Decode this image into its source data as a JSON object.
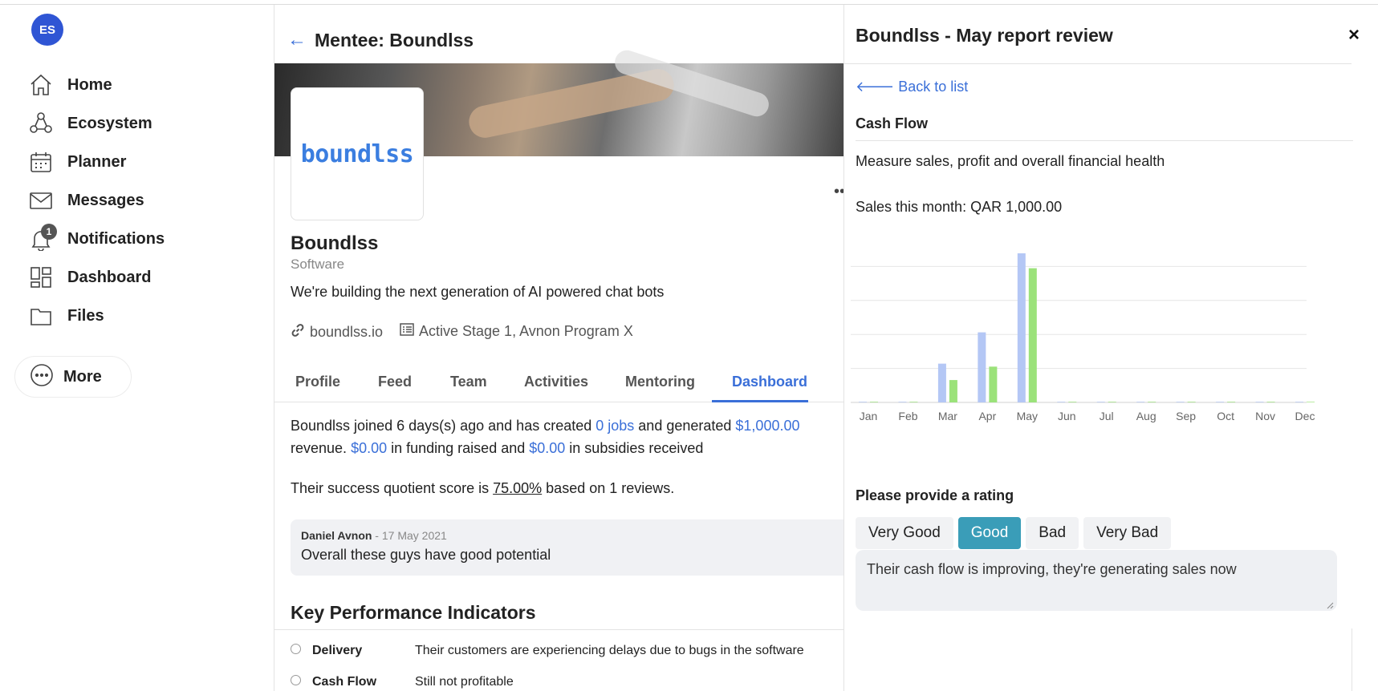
{
  "user": {
    "initials": "ES"
  },
  "sidebar": {
    "items": [
      {
        "label": "Home",
        "icon": "home-icon"
      },
      {
        "label": "Ecosystem",
        "icon": "ecosystem-icon"
      },
      {
        "label": "Planner",
        "icon": "calendar-icon"
      },
      {
        "label": "Messages",
        "icon": "envelope-icon"
      },
      {
        "label": "Notifications",
        "icon": "bell-icon",
        "badge": "1"
      },
      {
        "label": "Dashboard",
        "icon": "dashboard-icon"
      },
      {
        "label": "Files",
        "icon": "folder-icon"
      },
      {
        "label": "More",
        "icon": "more-icon"
      }
    ]
  },
  "main": {
    "title": "Mentee: Boundlss",
    "logo_text": "boundlss",
    "company": {
      "name": "Boundlss",
      "category": "Software",
      "description": "We're building the next generation of AI powered chat bots",
      "website": "boundlss.io",
      "stage": "Active Stage 1, Avnon Program X"
    },
    "tabs": [
      "Profile",
      "Feed",
      "Team",
      "Activities",
      "Mentoring",
      "Dashboard"
    ],
    "active_tab": "Dashboard",
    "summary": {
      "p1": "Boundlss joined 6 days(s) ago and has created ",
      "jobs": "0 jobs",
      "p2": " and generated ",
      "revenue": "$1,000.00",
      "p3": " revenue. ",
      "funding": "$0.00",
      "p4": " in funding raised and ",
      "subsidies": "$0.00",
      "p5": " in subsidies received"
    },
    "score": {
      "prefix": "Their success quotient score is ",
      "value": "75.00%",
      "suffix": " based on 1 reviews."
    },
    "review": {
      "author": "Daniel Avnon",
      "date": " - 17 May 2021",
      "text": "Overall these guys have good potential"
    },
    "kpi": {
      "title": "Key Performance Indicators",
      "rows": [
        {
          "name": "Delivery",
          "note": "Their customers are experiencing delays due to bugs in the software"
        },
        {
          "name": "Cash Flow",
          "note": "Still not profitable"
        }
      ]
    }
  },
  "panel": {
    "title": "Boundlss - May report review",
    "close_glyph": "×",
    "back_label": "Back to list",
    "section_title": "Cash Flow",
    "section_desc": "Measure sales, profit and overall financial health",
    "sales_text": "Sales this month: QAR 1,000.00",
    "rating_title": "Please provide a rating",
    "rating_options": [
      "Very Good",
      "Good",
      "Bad",
      "Very Bad"
    ],
    "rating_selected": "Good",
    "comment": "Their cash flow is improving, they're generating sales now"
  },
  "colors": {
    "accent": "#3a6fd8",
    "rating_selected": "#3a9db8",
    "series_blue": "#b4c7f5",
    "series_green": "#9be27a"
  },
  "chart_data": {
    "type": "bar",
    "categories": [
      "Jan",
      "Feb",
      "Mar",
      "Apr",
      "May",
      "Jun",
      "Jul",
      "Aug",
      "Sep",
      "Oct",
      "Nov",
      "Dec"
    ],
    "series": [
      {
        "values": [
          0,
          0,
          260,
          470,
          1000,
          0,
          0,
          0,
          0,
          0,
          0,
          0
        ],
        "color": "#b4c7f5"
      },
      {
        "values": [
          0,
          0,
          150,
          240,
          900,
          0,
          0,
          0,
          0,
          0,
          0,
          0
        ],
        "color": "#9be27a"
      }
    ],
    "ylim": [
      0,
      1000
    ],
    "grid": true,
    "legend": false
  }
}
